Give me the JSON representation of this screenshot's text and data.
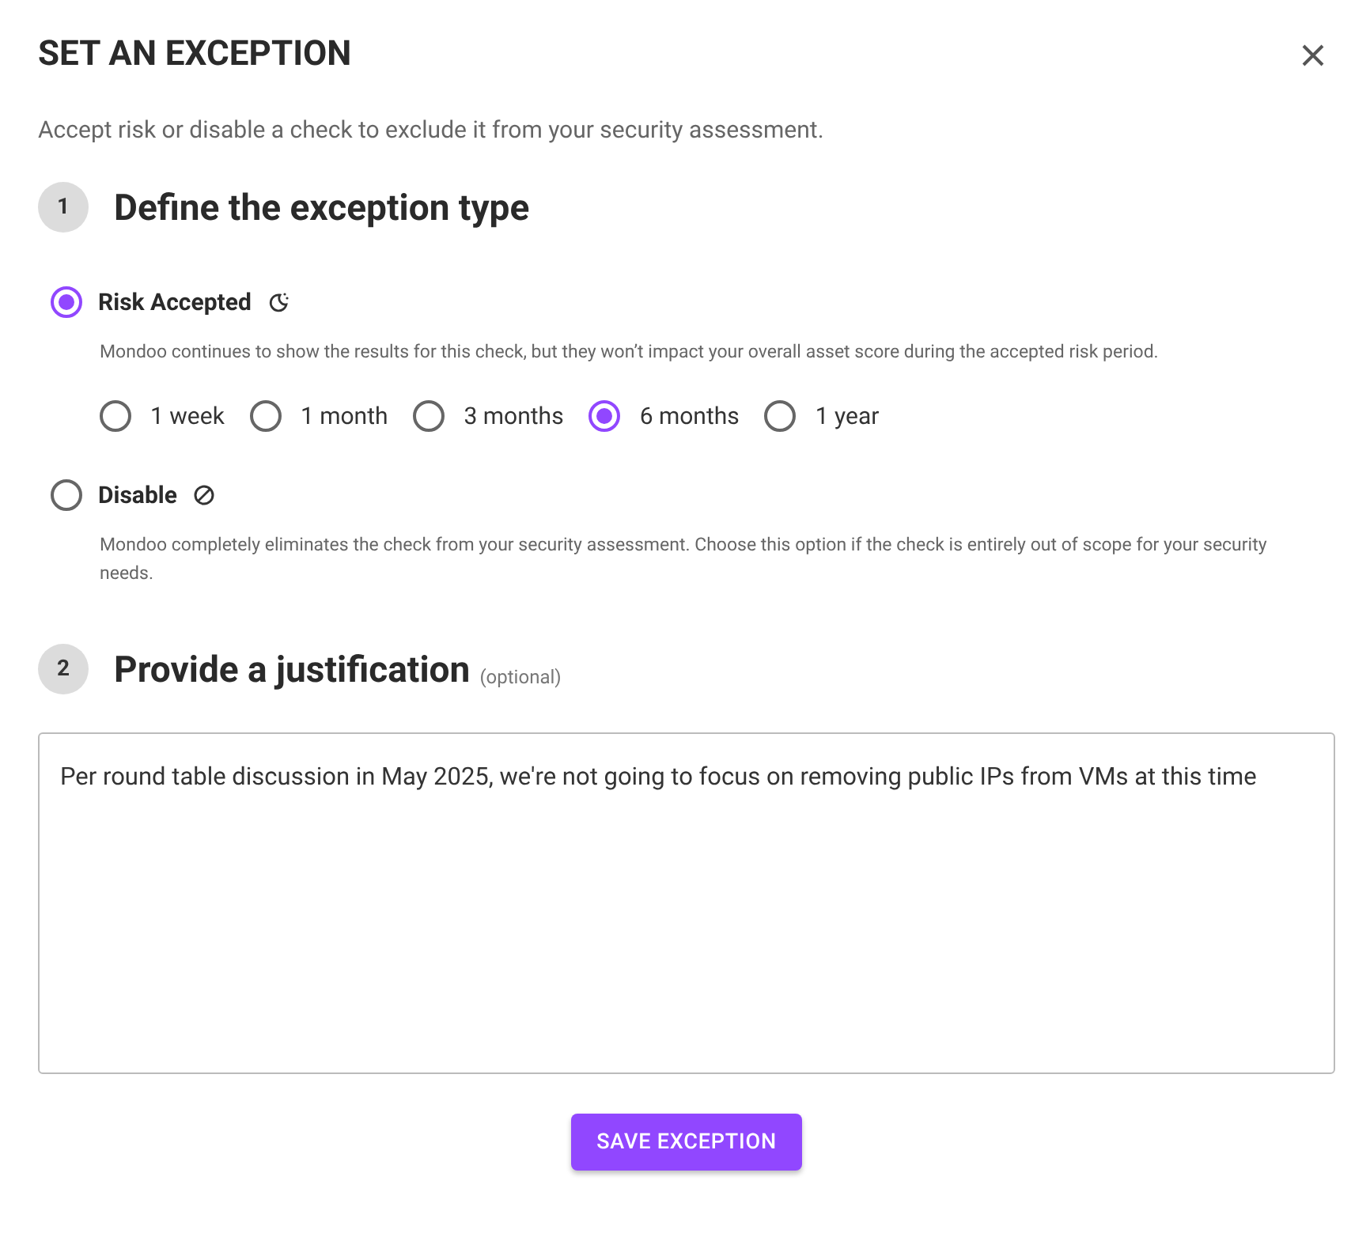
{
  "dialog": {
    "title": "SET AN EXCEPTION",
    "subtitle": "Accept risk or disable a check to exclude it from your security assessment."
  },
  "step_1": {
    "number": "1",
    "heading": "Define the exception type",
    "options": [
      {
        "kind": "accept",
        "label": "Risk Accepted",
        "selected": true,
        "description": "Mondoo continues to show the results for this check, but they won’t impact your overall asset score during the accepted risk period.",
        "periods": [
          {
            "label": "1 week",
            "selected": false
          },
          {
            "label": "1 month",
            "selected": false
          },
          {
            "label": "3 months",
            "selected": false
          },
          {
            "label": "6 months",
            "selected": true
          },
          {
            "label": "1 year",
            "selected": false
          }
        ]
      },
      {
        "kind": "disable",
        "label": "Disable",
        "selected": false,
        "description": "Mondoo completely eliminates the check from your security assessment. Choose this option if the check is entirely out of scope for your security needs."
      }
    ]
  },
  "step_2": {
    "number": "2",
    "heading": "Provide a justification",
    "note": "(optional)",
    "justification": "Per round table discussion in May 2025, we're not going to focus on removing public IPs from VMs at this time"
  },
  "save_button": "SAVE EXCEPTION"
}
